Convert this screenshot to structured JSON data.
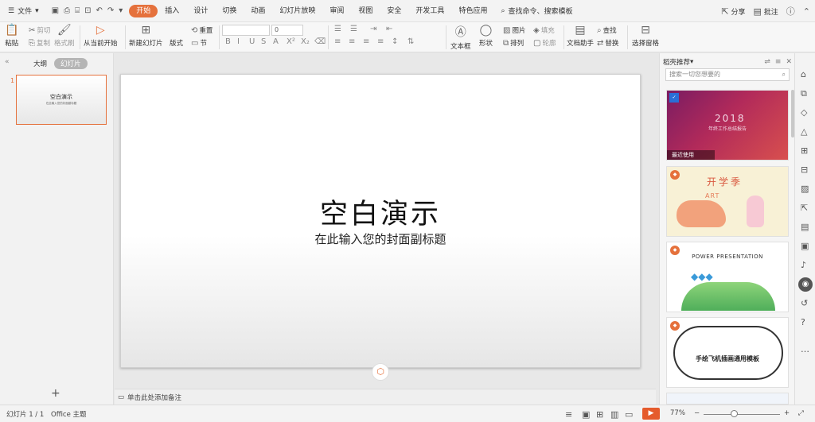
{
  "menubar": {
    "file_label": "文件",
    "tabs": [
      {
        "label": "开始",
        "active": true
      },
      {
        "label": "插入"
      },
      {
        "label": "设计"
      },
      {
        "label": "切换"
      },
      {
        "label": "动画"
      },
      {
        "label": "幻灯片放映"
      },
      {
        "label": "审阅"
      },
      {
        "label": "视图"
      },
      {
        "label": "安全"
      },
      {
        "label": "开发工具"
      },
      {
        "label": "特色应用"
      }
    ],
    "search_label": "查找命令、搜索模板",
    "share_label": "分享",
    "comment_label": "批注",
    "accent_color": "#e5713c"
  },
  "ribbon": {
    "paste": "粘贴",
    "cut": "剪切",
    "copy": "复制",
    "format_painter": "格式刷",
    "from_current": "从当前开始",
    "new_slide": "新建幻灯片",
    "layout": "版式",
    "section": "节",
    "reset": "重置",
    "font_size_value": "0",
    "textbox": "文本框",
    "shape": "形状",
    "picture": "图片",
    "arrange": "排列",
    "fill": "填充",
    "outline": "轮廓",
    "doc_assistant": "文档助手",
    "find": "查找",
    "replace": "替换",
    "select_pane": "选择窗格"
  },
  "leftpanel": {
    "outline_tab": "大纲",
    "slides_tab": "幻灯片",
    "slide_number": "1",
    "thumb_title": "空白演示",
    "thumb_sub": "在此输入您的封面副标题"
  },
  "slide": {
    "title": "空白演示",
    "subtitle": "在此输入您的封面副标题",
    "notes_placeholder": "单击此处添加备注"
  },
  "rightpanel": {
    "header": "稻壳推荐",
    "search_placeholder": "搜索一切您想要的",
    "templates": [
      {
        "year": "2018",
        "subtitle": "年终工作总结报告",
        "label": "最近使用"
      },
      {
        "title": "开学季",
        "art": "ART"
      },
      {
        "title": "POWER PRESENTATION"
      },
      {
        "title": "手绘飞机插画通用模板"
      }
    ]
  },
  "statusbar": {
    "slide_info": "幻灯片 1 / 1",
    "theme": "Office 主题",
    "zoom": "77%"
  }
}
